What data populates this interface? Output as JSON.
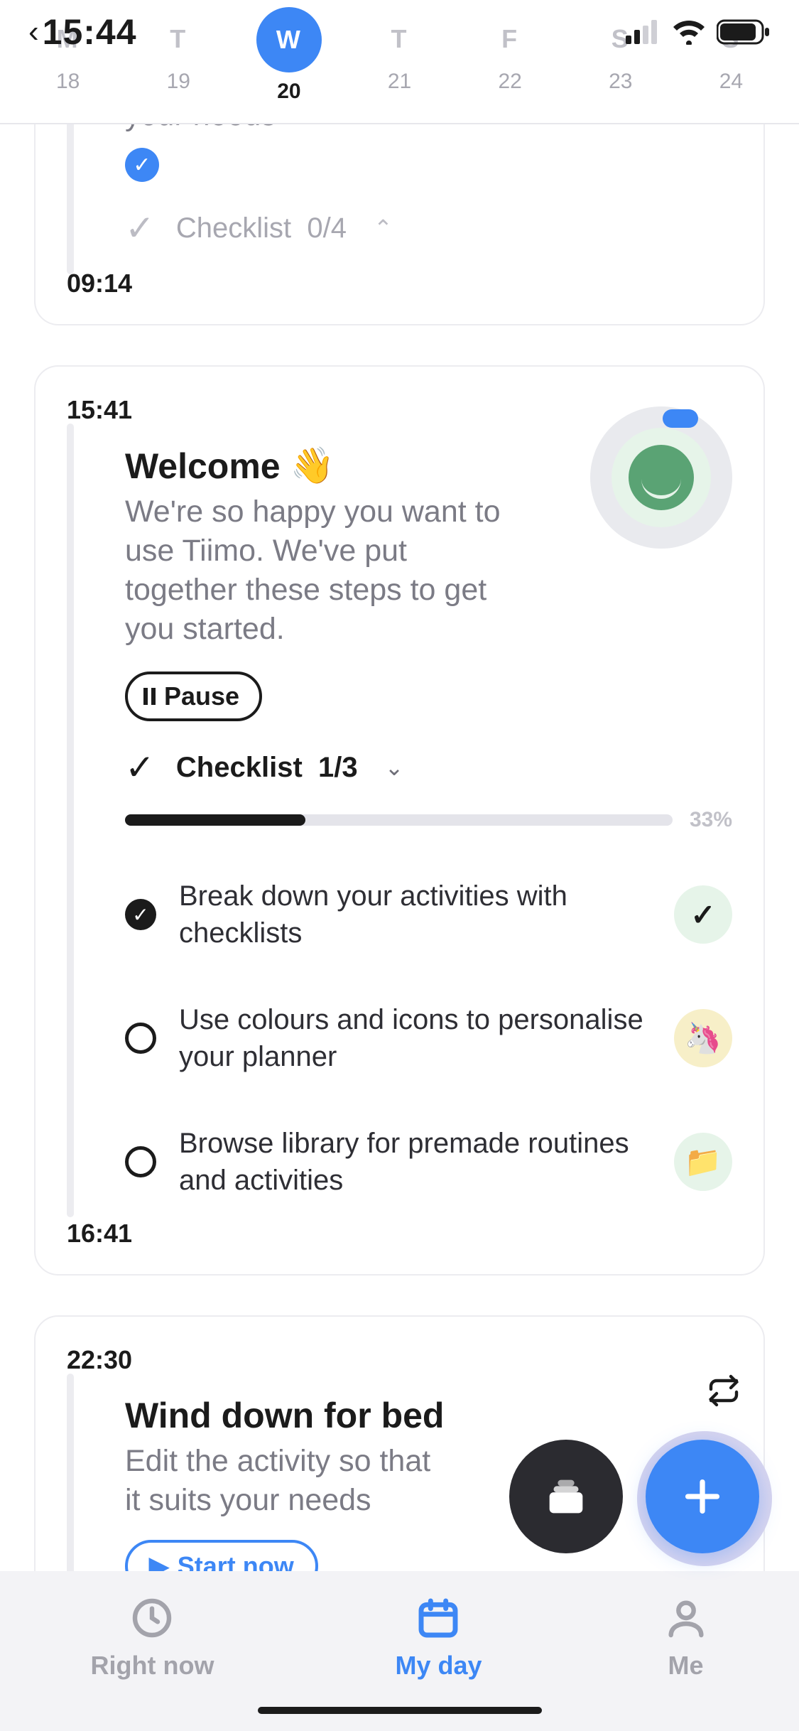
{
  "status": {
    "time": "15:44"
  },
  "week": {
    "days": [
      {
        "dow": "M",
        "num": "18",
        "active": false
      },
      {
        "dow": "T",
        "num": "19",
        "active": false
      },
      {
        "dow": "W",
        "num": "20",
        "active": true
      },
      {
        "dow": "T",
        "num": "21",
        "active": false
      },
      {
        "dow": "F",
        "num": "22",
        "active": false
      },
      {
        "dow": "S",
        "num": "23",
        "active": false
      },
      {
        "dow": "S",
        "num": "24",
        "active": false
      }
    ]
  },
  "cards": {
    "partial": {
      "desc_fragment": "your needs",
      "checklist_label": "Checklist",
      "checklist_count": "0/4",
      "time_end": "09:14"
    },
    "welcome": {
      "time_start": "15:41",
      "title": "Welcome",
      "emoji": "👋",
      "desc": "We're so happy you want to use Tiimo. We've put together these steps to get you started.",
      "pause_label": "Pause",
      "checklist_label": "Checklist",
      "checklist_count": "1/3",
      "progress_pct": "33%",
      "progress_width": "33%",
      "items": [
        {
          "done": true,
          "text": "Break down your activities with checklists",
          "icon": "check"
        },
        {
          "done": false,
          "text": "Use colours and icons to personalise your planner",
          "icon": "unicorn"
        },
        {
          "done": false,
          "text": "Browse library for premade routines and activities",
          "icon": "folder"
        }
      ],
      "time_end": "16:41"
    },
    "wind": {
      "time_start": "22:30",
      "title": "Wind down for bed",
      "desc": "Edit the activity so that it suits your needs",
      "start_label": "Start now"
    }
  },
  "tabs": {
    "right_now": "Right now",
    "my_day": "My day",
    "me": "Me"
  }
}
